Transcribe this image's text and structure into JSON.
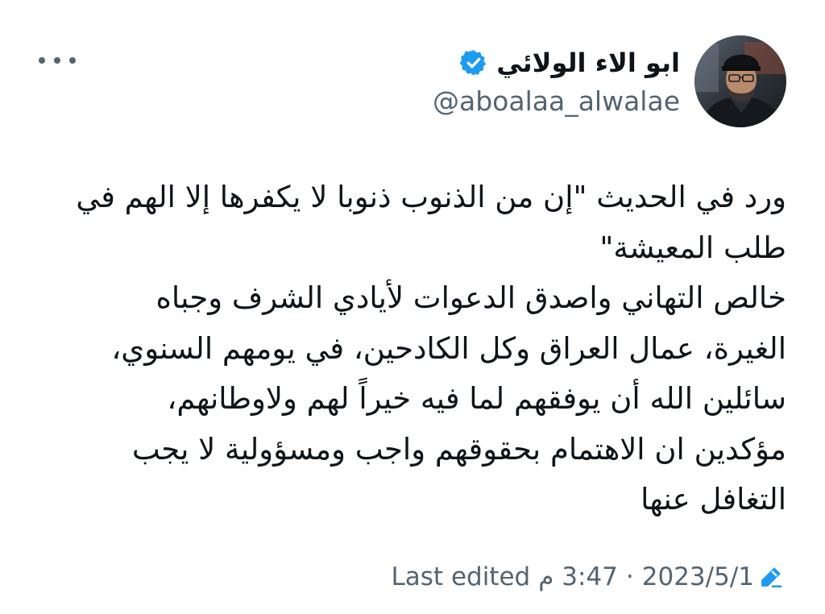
{
  "author": {
    "name": "ابو الاء الولائي",
    "handle": "@aboalaa_alwalae",
    "verified": true
  },
  "tweet": {
    "lines": [
      "ورد في الحديث \"إن من الذنوب ذنوبا لا يكفرها إلا الهم في",
      "طلب المعيشة\"",
      "خالص التهاني واصدق الدعوات لأيادي الشرف وجباه",
      "الغيرة، عمال العراق وكل الكادحين، في يومهم السنوي،",
      "سائلين الله أن يوفقهم لما فيه خيراً لهم ولاوطانهم،",
      "مؤكدين ان الاهتمام بحقوقهم واجب ومسؤولية لا يجب",
      "التغافل عنها"
    ]
  },
  "footer": {
    "edited_label": "Last edited",
    "time": "3:47 م",
    "separator": "·",
    "date": "2023/5/1"
  },
  "icons": {
    "more": "more-horizontal-icon",
    "verified": "verified-badge-icon",
    "edit": "edit-pencil-icon"
  },
  "colors": {
    "accent": "#1d9bf0",
    "text": "#0f1419",
    "secondary": "#536471",
    "background": "#ffffff"
  }
}
